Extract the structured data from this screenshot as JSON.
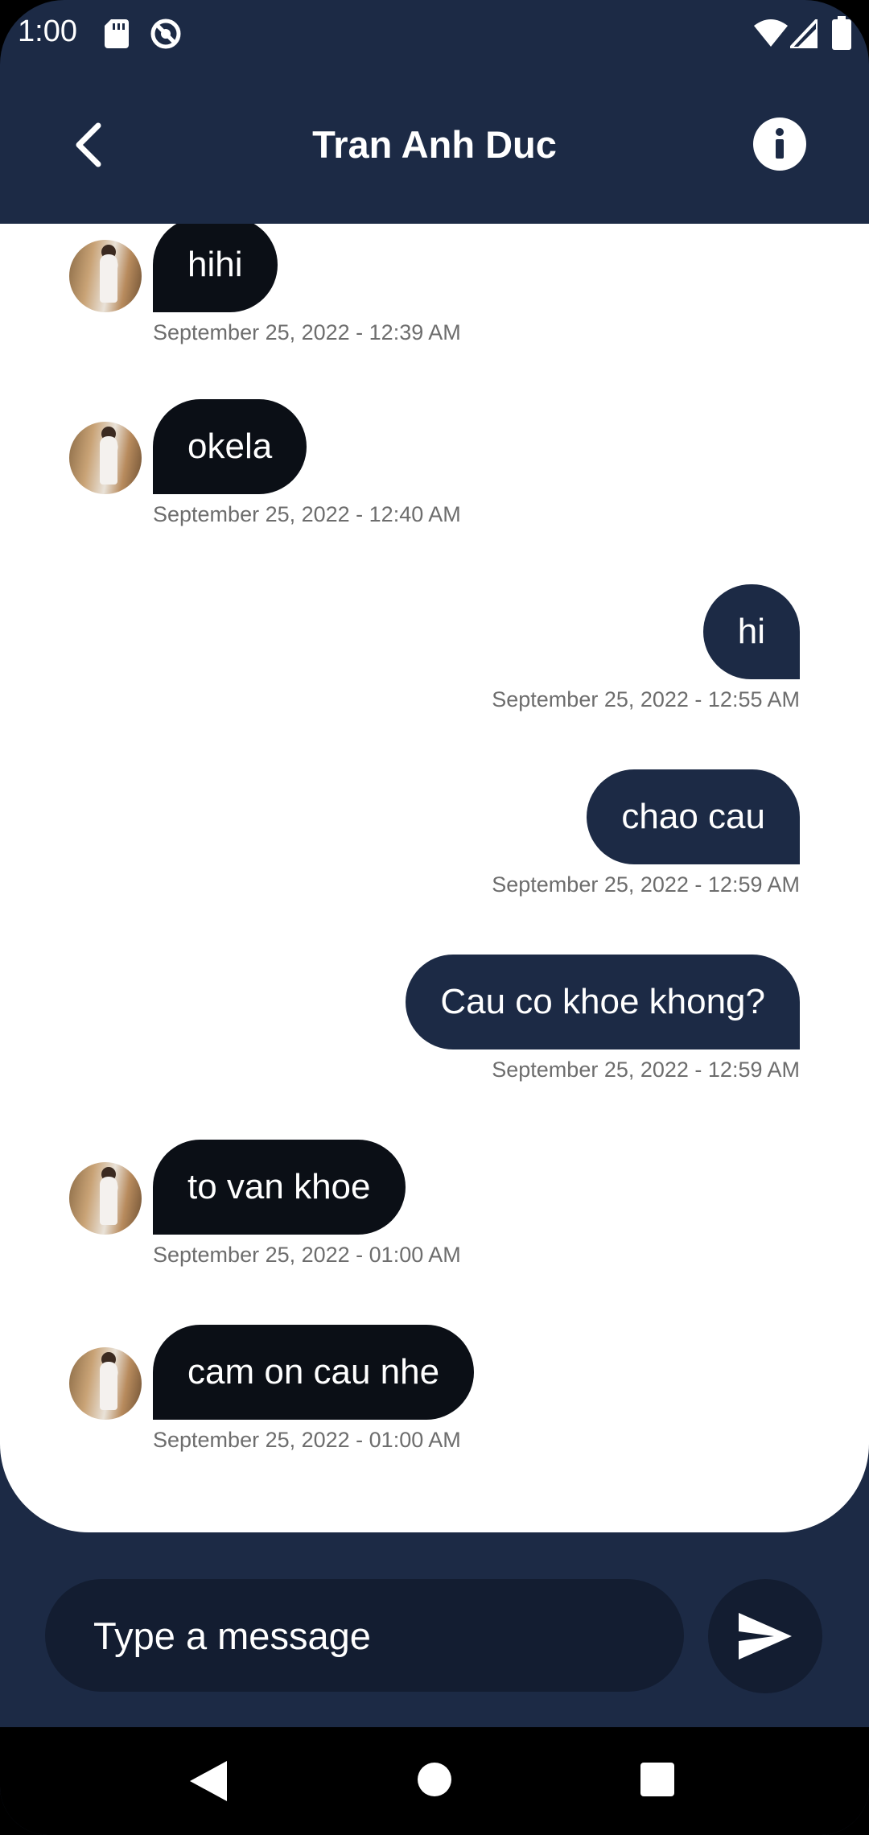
{
  "status_bar": {
    "time": "1:00",
    "icons": [
      "sd-card-icon",
      "sync-off-icon",
      "wifi-icon",
      "signal-icon",
      "battery-icon"
    ]
  },
  "header": {
    "title": "Tran Anh Duc",
    "back_icon": "chevron-left-icon",
    "info_icon": "info-icon"
  },
  "messages": [
    {
      "direction": "in",
      "text": "hihi",
      "time": "September 25, 2022 - 12:39 AM"
    },
    {
      "direction": "in",
      "text": "okela",
      "time": "September 25, 2022 - 12:40 AM"
    },
    {
      "direction": "out",
      "text": "hi",
      "time": "September 25, 2022 - 12:55 AM"
    },
    {
      "direction": "out",
      "text": "chao cau",
      "time": "September 25, 2022 - 12:59 AM"
    },
    {
      "direction": "out",
      "text": "Cau co khoe khong?",
      "time": "September 25, 2022 - 12:59 AM"
    },
    {
      "direction": "in",
      "text": "to van khoe",
      "time": "September 25, 2022 - 01:00 AM"
    },
    {
      "direction": "in",
      "text": "cam on cau nhe",
      "time": "September 25, 2022 - 01:00 AM"
    }
  ],
  "composer": {
    "placeholder": "Type a message",
    "send_icon": "send-icon"
  },
  "colors": {
    "primary": "#1c2a45",
    "incoming_bubble": "#0b0f16",
    "timestamp": "#6d6d6d"
  }
}
